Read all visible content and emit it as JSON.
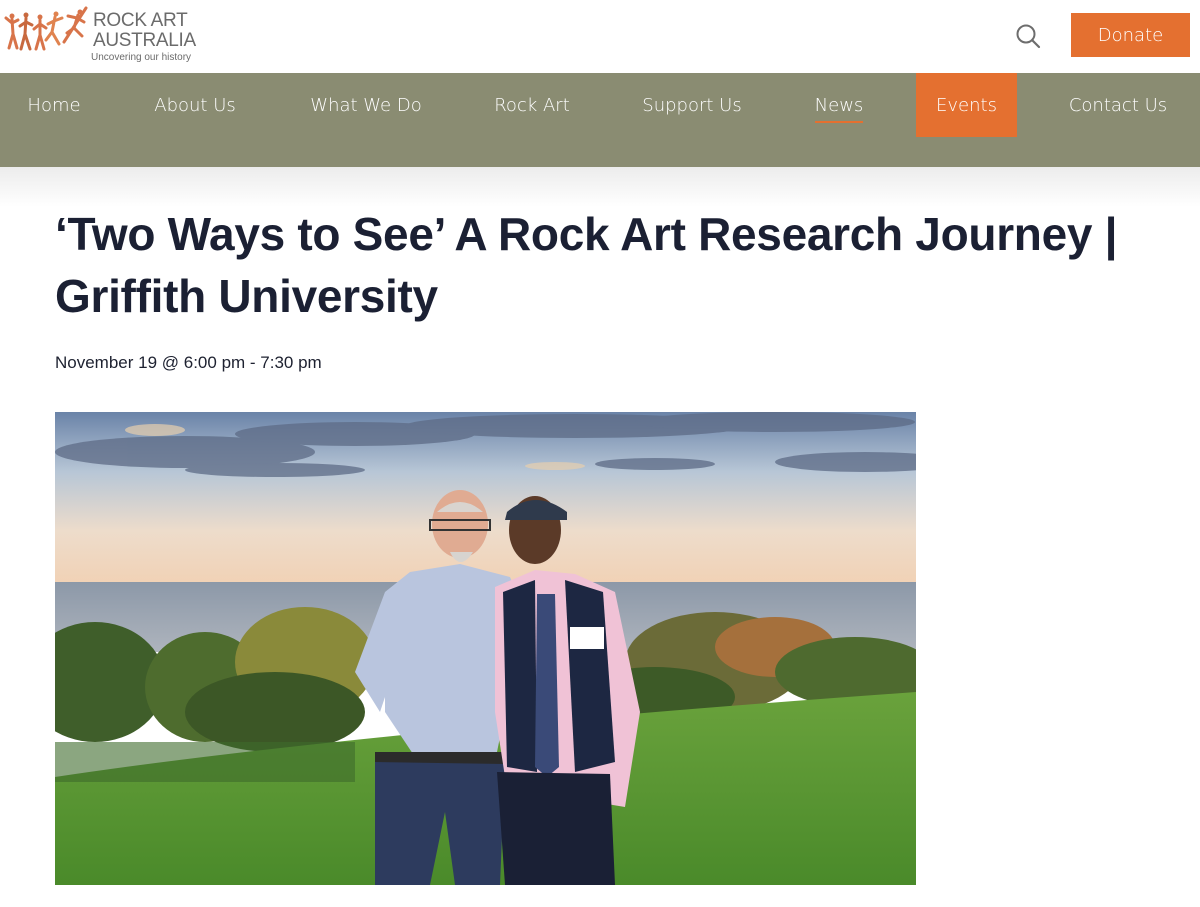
{
  "site": {
    "logo_line1": "ROCK ART",
    "logo_line2": "AUSTRALIA",
    "tagline": "Uncovering our history",
    "logo_icon": "rock-art-figures-logo",
    "brand_color": "#e47030",
    "nav_color": "#8a8c72"
  },
  "header": {
    "search_icon": "search-icon",
    "donate_label": "Donate"
  },
  "nav": {
    "items": [
      {
        "label": "Home"
      },
      {
        "label": "About Us"
      },
      {
        "label": "What We Do"
      },
      {
        "label": "Rock Art"
      },
      {
        "label": "Support Us"
      },
      {
        "label": "News",
        "state": "underlined"
      },
      {
        "label": "Events",
        "state": "active"
      },
      {
        "label": "Contact Us"
      }
    ]
  },
  "event": {
    "title": "‘Two Ways to See’ A Rock Art Research Journey | Griffith University",
    "date": "November 19 @ 6:00 pm - 7:30 pm",
    "image": "photo of two men standing on a lawn by the ocean at sunset"
  }
}
